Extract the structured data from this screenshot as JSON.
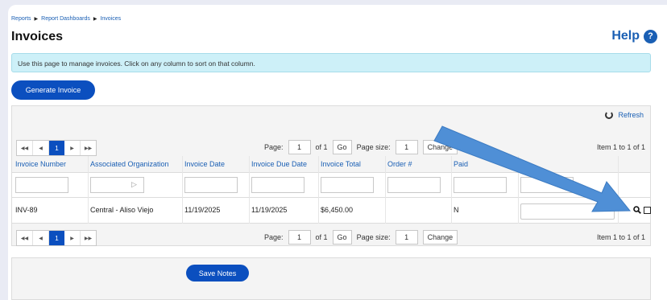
{
  "breadcrumb": [
    "Reports",
    "Report Dashboards",
    "Invoices"
  ],
  "page_title": "Invoices",
  "help_label": "Help",
  "help_icon_glyph": "?",
  "info_text": "Use this page to manage invoices. Click on any column to sort on that column.",
  "generate_button": "Generate Invoice",
  "refresh_label": "Refresh",
  "pager": {
    "current_page": "1",
    "page_label": "Page:",
    "page_value": "1",
    "of_label": "of 1",
    "go_label": "Go",
    "size_label": "Page size:",
    "size_value": "1",
    "change_label": "Change",
    "item_info": "Item 1 to 1 of 1"
  },
  "columns": [
    "Invoice Number",
    "Associated Organization",
    "Invoice Date",
    "Invoice Due Date",
    "Invoice Total",
    "Order #",
    "Paid"
  ],
  "rows": [
    {
      "invoice_number": "INV-89",
      "organization": "Central - Aliso Viejo",
      "invoice_date": "11/19/2025",
      "due_date": "11/19/2025",
      "total": "$6,450.00",
      "order": "",
      "paid": "N"
    }
  ],
  "save_notes_button": "Save Notes",
  "colors": {
    "accent": "#0b4fbf",
    "link": "#1a5fb4",
    "info_bg": "#cdf0f8",
    "annotation_arrow": "#4f8fd6"
  }
}
